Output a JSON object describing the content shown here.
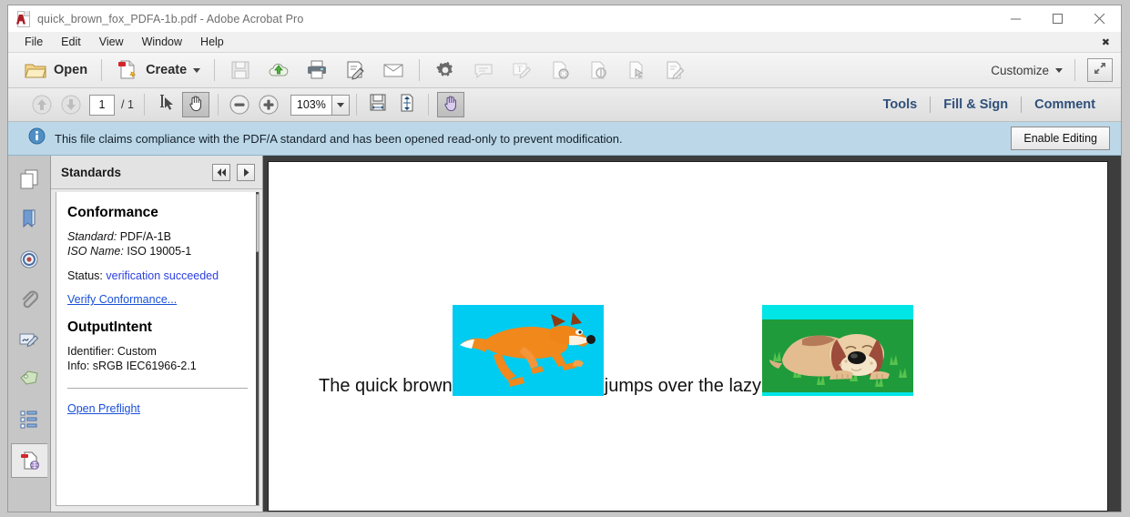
{
  "window": {
    "title": "quick_brown_fox_PDFA-1b.pdf - Adobe Acrobat Pro",
    "app_icon": "pdf-file-icon",
    "minimize_label": "minimize-icon",
    "maximize_label": "maximize-icon",
    "close_label": "close-icon"
  },
  "menu": {
    "items": [
      "File",
      "Edit",
      "View",
      "Window",
      "Help"
    ],
    "close_glyph": "✖"
  },
  "toolbar": {
    "open_label": "Open",
    "create_label": "Create",
    "customize_label": "Customize",
    "icons": [
      "save-icon",
      "upload-cloud-icon",
      "print-icon",
      "sign-icon",
      "email-icon",
      "gear-icon",
      "comment-icon",
      "text-edit-icon",
      "delete-page-icon",
      "stamp-icon",
      "pointer-doc-icon",
      "edit-doc-icon"
    ],
    "fullscreen_label": "fullscreen-icon"
  },
  "navtoolbar": {
    "page_current": "1",
    "page_total": "/ 1",
    "zoom_value": "103%",
    "prev_label": "previous-page-icon",
    "next_label": "next-page-icon",
    "select_tool": "select-tool-icon",
    "hand_tool": "hand-tool-icon",
    "zoom_out": "zoom-out-icon",
    "zoom_in": "zoom-in-icon",
    "fit_width": "fit-width-icon",
    "fit_page": "fit-page-icon",
    "highlight_tool": "highlight-hand-icon",
    "right_links": [
      "Tools",
      "Fill & Sign",
      "Comment"
    ]
  },
  "notice": {
    "icon": "info-icon",
    "message": "This file claims compliance with the PDF/A standard and has been opened read-only to prevent modification.",
    "button_label": "Enable Editing"
  },
  "rail": {
    "items": [
      "page-thumbnails-icon",
      "bookmarks-icon",
      "destinations-icon",
      "attachments-icon",
      "signatures-icon",
      "tags-icon",
      "content-structure-icon",
      "standards-icon"
    ],
    "selected_index": 7
  },
  "panel": {
    "title": "Standards",
    "collapse_label": "collapse-panel-icon",
    "expand_label": "expand-panel-icon",
    "conformance_heading": "Conformance",
    "standard_label": "Standard:",
    "standard_value": "PDF/A-1B",
    "iso_label": "ISO Name:",
    "iso_value": "ISO 19005-1",
    "status_label": "Status:",
    "status_value": "verification succeeded",
    "verify_link": "Verify Conformance...",
    "outputintent_heading": "OutputIntent",
    "identifier_line": "Identifier: Custom",
    "info_line": "Info: sRGB IEC61966-2.1",
    "preflight_link": "Open Preflight"
  },
  "document": {
    "text_before": "The quick brown",
    "text_middle": "jumps over the lazy",
    "fox_image_alt": "running-fox-image",
    "dog_image_alt": "sleeping-dog-image"
  },
  "colors": {
    "accent_blue": "#2f4f7a",
    "link_blue": "#1a4fd6",
    "status_blue": "#2b3fe0",
    "notice_bg": "#bcd8e8",
    "viewer_bg": "#3d3d3d",
    "fox_bg": "#00ccf2",
    "dog_sky": "#00e5e5",
    "dog_grass": "#1f9b3c"
  }
}
